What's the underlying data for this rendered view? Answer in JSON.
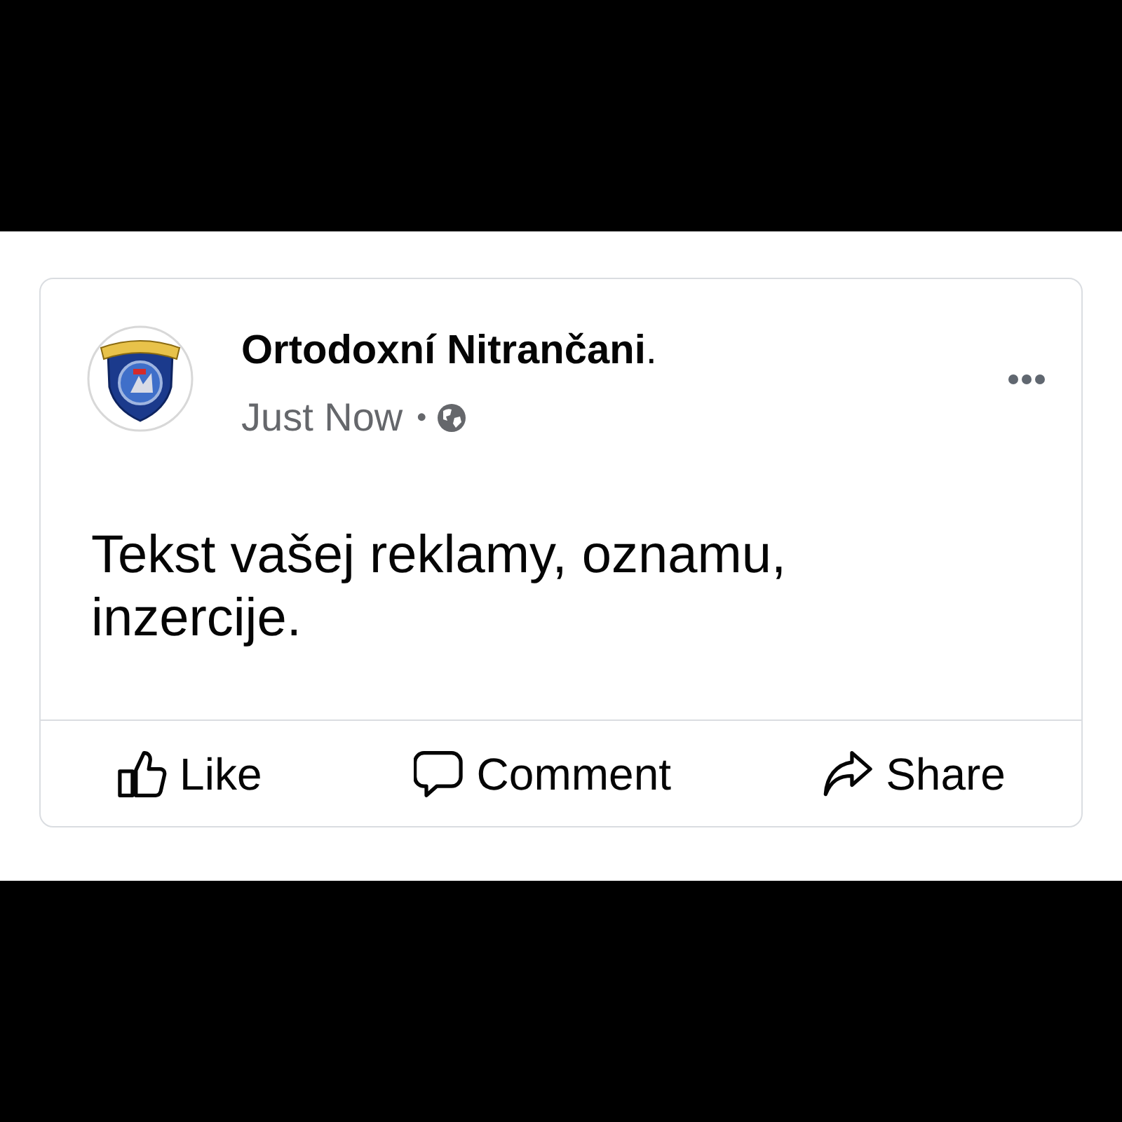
{
  "post": {
    "author": "**Ortodoxní Nitrančani**.",
    "time": "Just Now",
    "separator": "•",
    "text": "Tekst vašej reklamy, oznamu, inzercije."
  },
  "actions": [
    {
      "kind": "like",
      "label": "Like"
    },
    {
      "kind": "comment",
      "label": "Comment"
    },
    {
      "kind": "share",
      "label": "Share"
    }
  ]
}
